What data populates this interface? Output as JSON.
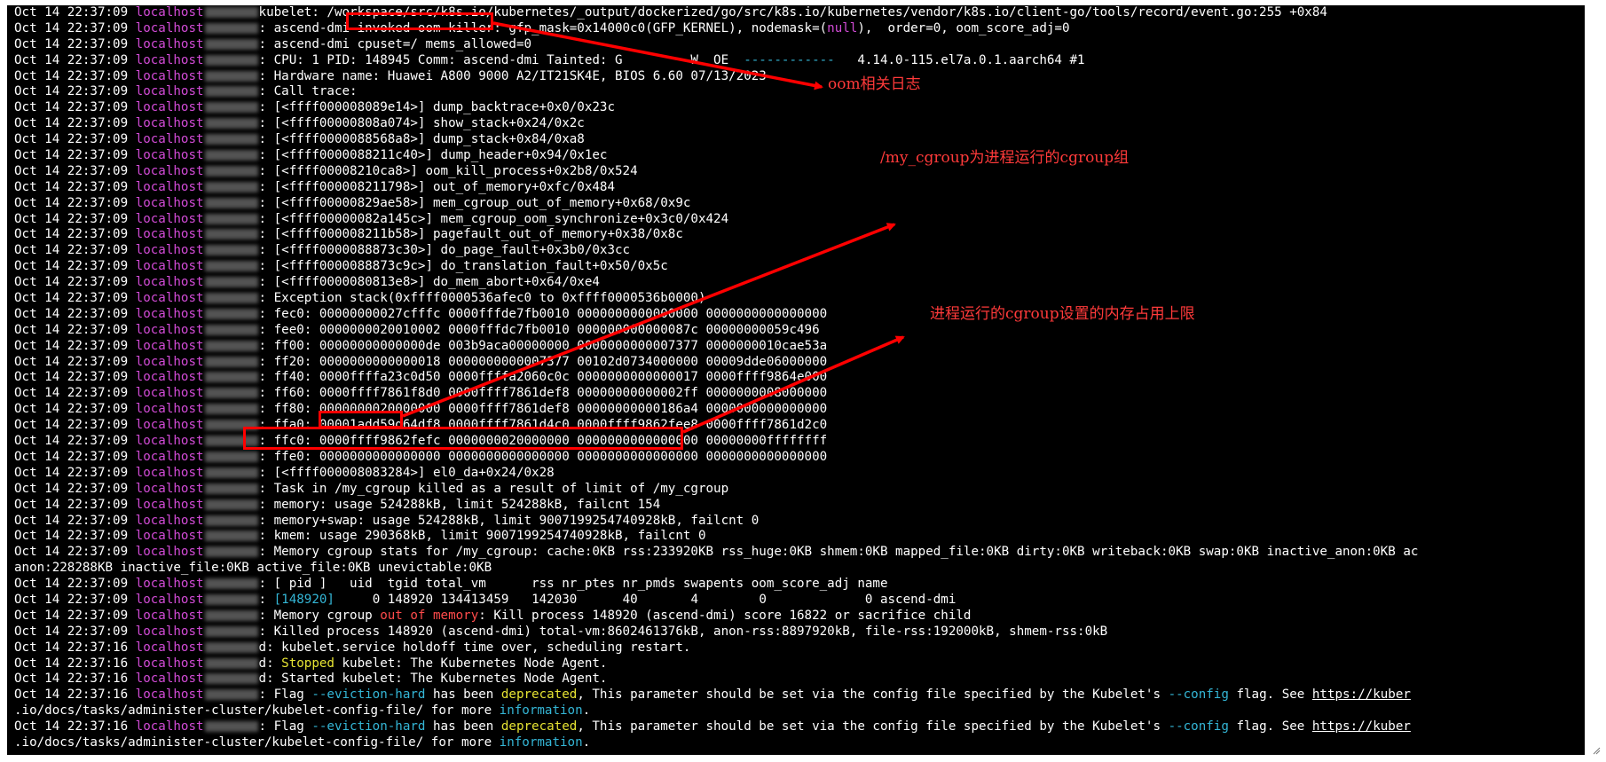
{
  "terminal": {
    "lines": [
      [
        {
          "t": "Oct 14 22:37:09 "
        },
        {
          "t": "localhost",
          "c": "host"
        },
        {
          "b": 1
        },
        {
          "t": "kubelet: /workspace/src/k8s.io/kubernetes/_output/dockerized/go/src/k8s.io/kubernetes/vendor/k8s.io/client-go/tools/record/event.go:255 +0x84"
        }
      ],
      [
        {
          "t": "Oct 14 22:37:09 "
        },
        {
          "t": "localhost",
          "c": "host"
        },
        {
          "b": 1
        },
        {
          "t": ": ascend-dmi invoked oom-killer: gfp_mask=0x14000c0(GFP_KERNEL), nodemask=("
        },
        {
          "t": "null",
          "c": "hl-magenta"
        },
        {
          "t": "),  order=0, oom_score_adj=0"
        }
      ],
      [
        {
          "t": "Oct 14 22:37:09 "
        },
        {
          "t": "localhost",
          "c": "host"
        },
        {
          "b": 1
        },
        {
          "t": ": ascend-dmi cpuset=/ mems_allowed=0"
        }
      ],
      [
        {
          "t": "Oct 14 22:37:09 "
        },
        {
          "t": "localhost",
          "c": "host"
        },
        {
          "b": 1
        },
        {
          "t": ": CPU: 1 PID: 148945 Comm: ascend-dmi Tainted: G         W  OE  "
        },
        {
          "t": "------------",
          "c": "hl-cyan"
        },
        {
          "t": "   4.14.0-115.el7a.0.1.aarch64 #1"
        }
      ],
      [
        {
          "t": "Oct 14 22:37:09 "
        },
        {
          "t": "localhost",
          "c": "host"
        },
        {
          "b": 1
        },
        {
          "t": ": Hardware name: Huawei A800 9000 A2/IT21SK4E, BIOS 6.60 07/13/2023"
        }
      ],
      [
        {
          "t": "Oct 14 22:37:09 "
        },
        {
          "t": "localhost",
          "c": "host"
        },
        {
          "b": 1
        },
        {
          "t": ": Call trace:"
        }
      ],
      [
        {
          "t": "Oct 14 22:37:09 "
        },
        {
          "t": "localhost",
          "c": "host"
        },
        {
          "b": 1
        },
        {
          "t": ": [<ffff000008089e14>] dump_backtrace+0x0/0x23c"
        }
      ],
      [
        {
          "t": "Oct 14 22:37:09 "
        },
        {
          "t": "localhost",
          "c": "host"
        },
        {
          "b": 1
        },
        {
          "t": ": [<ffff00000808a074>] show_stack+0x24/0x2c"
        }
      ],
      [
        {
          "t": "Oct 14 22:37:09 "
        },
        {
          "t": "localhost",
          "c": "host"
        },
        {
          "b": 1
        },
        {
          "t": ": [<ffff0000088568a8>] dump_stack+0x84/0xa8"
        }
      ],
      [
        {
          "t": "Oct 14 22:37:09 "
        },
        {
          "t": "localhost",
          "c": "host"
        },
        {
          "b": 1
        },
        {
          "t": ": [<ffff0000088211c40>] dump_header+0x94/0x1ec"
        }
      ],
      [
        {
          "t": "Oct 14 22:37:09 "
        },
        {
          "t": "localhost",
          "c": "host"
        },
        {
          "b": 1
        },
        {
          "t": ": [<ffff00008210ca8>] oom_kill_process+0x2b8/0x524"
        }
      ],
      [
        {
          "t": "Oct 14 22:37:09 "
        },
        {
          "t": "localhost",
          "c": "host"
        },
        {
          "b": 1
        },
        {
          "t": ": [<ffff000008211798>] out_of_memory+0xfc/0x484"
        }
      ],
      [
        {
          "t": "Oct 14 22:37:09 "
        },
        {
          "t": "localhost",
          "c": "host"
        },
        {
          "b": 1
        },
        {
          "t": ": [<ffff00000829ae58>] mem_cgroup_out_of_memory+0x68/0x9c"
        }
      ],
      [
        {
          "t": "Oct 14 22:37:09 "
        },
        {
          "t": "localhost",
          "c": "host"
        },
        {
          "b": 1
        },
        {
          "t": ": [<ffff00000082a145c>] mem_cgroup_oom_synchronize+0x3c0/0x424"
        }
      ],
      [
        {
          "t": "Oct 14 22:37:09 "
        },
        {
          "t": "localhost",
          "c": "host"
        },
        {
          "b": 1
        },
        {
          "t": ": [<ffff000008211b58>] pagefault_out_of_memory+0x38/0x8c"
        }
      ],
      [
        {
          "t": "Oct 14 22:37:09 "
        },
        {
          "t": "localhost",
          "c": "host"
        },
        {
          "b": 1
        },
        {
          "t": ": [<ffff0000088873c30>] do_page_fault+0x3b0/0x3cc"
        }
      ],
      [
        {
          "t": "Oct 14 22:37:09 "
        },
        {
          "t": "localhost",
          "c": "host"
        },
        {
          "b": 1
        },
        {
          "t": ": [<ffff0000088873c9c>] do_translation_fault+0x50/0x5c"
        }
      ],
      [
        {
          "t": "Oct 14 22:37:09 "
        },
        {
          "t": "localhost",
          "c": "host"
        },
        {
          "b": 1
        },
        {
          "t": ": [<ffff0000080813e8>] do_mem_abort+0x64/0xe4"
        }
      ],
      [
        {
          "t": "Oct 14 22:37:09 "
        },
        {
          "t": "localhost",
          "c": "host"
        },
        {
          "b": 1
        },
        {
          "t": ": Exception stack(0xffff0000536afec0 to 0xffff0000536b0000)"
        }
      ],
      [
        {
          "t": "Oct 14 22:37:09 "
        },
        {
          "t": "localhost",
          "c": "host"
        },
        {
          "b": 1
        },
        {
          "t": ": fec0: 00000000027cfffc 0000fffde7fb0010 0000000000000000 0000000000000000"
        }
      ],
      [
        {
          "t": "Oct 14 22:37:09 "
        },
        {
          "t": "localhost",
          "c": "host"
        },
        {
          "b": 1
        },
        {
          "t": ": fee0: 0000000020010002 0000fffdc7fb0010 000000000000087c 00000000059c496"
        }
      ],
      [
        {
          "t": "Oct 14 22:37:09 "
        },
        {
          "t": "localhost",
          "c": "host"
        },
        {
          "b": 1
        },
        {
          "t": ": ff00: 00000000000000de 003b9aca00000000 0000000000007377 0000000010cae53a"
        }
      ],
      [
        {
          "t": "Oct 14 22:37:09 "
        },
        {
          "t": "localhost",
          "c": "host"
        },
        {
          "b": 1
        },
        {
          "t": ": ff20: 0000000000000018 0000000000007377 00102d0734000000 00009dde06000000"
        }
      ],
      [
        {
          "t": "Oct 14 22:37:09 "
        },
        {
          "t": "localhost",
          "c": "host"
        },
        {
          "b": 1
        },
        {
          "t": ": ff40: 0000ffffa23c0d50 0000ffffa2060c0c 0000000000000017 0000ffff9864e000"
        }
      ],
      [
        {
          "t": "Oct 14 22:37:09 "
        },
        {
          "t": "localhost",
          "c": "host"
        },
        {
          "b": 1
        },
        {
          "t": ": ff60: 0000ffff7861f8d0 0000ffff7861def8 00000000000002ff 0000000008000000"
        }
      ],
      [
        {
          "t": "Oct 14 22:37:09 "
        },
        {
          "t": "localhost",
          "c": "host"
        },
        {
          "b": 1
        },
        {
          "t": ": ff80: 0000000020000000 0000ffff7861def8 00000000000186a4 0000000000000000"
        }
      ],
      [
        {
          "t": "Oct 14 22:37:09 "
        },
        {
          "t": "localhost",
          "c": "host"
        },
        {
          "b": 1
        },
        {
          "t": ": ffa0: 00001add59d64df8 0000ffff7861d4c0 0000ffff9862fee8 0000ffff7861d2c0"
        }
      ],
      [
        {
          "t": "Oct 14 22:37:09 "
        },
        {
          "t": "localhost",
          "c": "host"
        },
        {
          "b": 1
        },
        {
          "t": ": ffc0: 0000ffff9862fefc 0000000020000000 0000000000000000 00000000ffffffff"
        }
      ],
      [
        {
          "t": "Oct 14 22:37:09 "
        },
        {
          "t": "localhost",
          "c": "host"
        },
        {
          "b": 1
        },
        {
          "t": ": ffe0: 0000000000000000 0000000000000000 0000000000000000 0000000000000000"
        }
      ],
      [
        {
          "t": "Oct 14 22:37:09 "
        },
        {
          "t": "localhost",
          "c": "host"
        },
        {
          "b": 1
        },
        {
          "t": ": [<ffff000008083284>] el0_da+0x24/0x28"
        }
      ],
      [
        {
          "t": "Oct 14 22:37:09 "
        },
        {
          "t": "localhost",
          "c": "host"
        },
        {
          "b": 1
        },
        {
          "t": ": Task in /my_cgroup killed as a result of limit of /my_cgroup"
        }
      ],
      [
        {
          "t": "Oct 14 22:37:09 "
        },
        {
          "t": "localhost",
          "c": "host"
        },
        {
          "b": 1
        },
        {
          "t": ": memory: usage 524288kB, limit 524288kB, failcnt 154"
        }
      ],
      [
        {
          "t": "Oct 14 22:37:09 "
        },
        {
          "t": "localhost",
          "c": "host"
        },
        {
          "b": 1
        },
        {
          "t": ": memory+swap: usage 524288kB, limit 9007199254740928kB, failcnt 0"
        }
      ],
      [
        {
          "t": "Oct 14 22:37:09 "
        },
        {
          "t": "localhost",
          "c": "host"
        },
        {
          "b": 1
        },
        {
          "t": ": kmem: usage 290368kB, limit 9007199254740928kB, failcnt 0"
        }
      ],
      [
        {
          "t": "Oct 14 22:37:09 "
        },
        {
          "t": "localhost",
          "c": "host"
        },
        {
          "b": 1
        },
        {
          "t": ": Memory cgroup stats for /my_cgroup: cache:0KB rss:233920KB rss_huge:0KB shmem:0KB mapped_file:0KB dirty:0KB writeback:0KB swap:0KB inactive_anon:0KB ac"
        }
      ],
      [
        {
          "t": "anon:228288KB inactive_file:0KB active_file:0KB unevictable:0KB"
        }
      ],
      [
        {
          "t": "Oct 14 22:37:09 "
        },
        {
          "t": "localhost",
          "c": "host"
        },
        {
          "b": 1
        },
        {
          "t": ": [ pid ]   uid  tgid total_vm      rss nr_ptes nr_pmds swapents oom_score_adj name"
        }
      ],
      [
        {
          "t": "Oct 14 22:37:09 "
        },
        {
          "t": "localhost",
          "c": "host"
        },
        {
          "b": 1
        },
        {
          "t": ": "
        },
        {
          "t": "[148920]",
          "c": "hl-cyan"
        },
        {
          "t": "     0 148920 134413459   142030      40       4        0             0 ascend-dmi"
        }
      ],
      [
        {
          "t": "Oct 14 22:37:09 "
        },
        {
          "t": "localhost",
          "c": "host"
        },
        {
          "b": 1
        },
        {
          "t": ": Memory cgroup "
        },
        {
          "t": "out of memory",
          "c": "hl-red"
        },
        {
          "t": ": Kill process 148920 (ascend-dmi) score 16822 or sacrifice child"
        }
      ],
      [
        {
          "t": "Oct 14 22:37:09 "
        },
        {
          "t": "localhost",
          "c": "host"
        },
        {
          "b": 1
        },
        {
          "t": ": Killed process 148920 (ascend-dmi) total-vm:8602461376kB, anon-rss:8897920kB, file-rss:192000kB, shmem-rss:0kB"
        }
      ],
      [
        {
          "t": "Oct 14 22:37:16 "
        },
        {
          "t": "localhost",
          "c": "host"
        },
        {
          "b": 1
        },
        {
          "t": "d: kubelet.service holdoff time over, scheduling restart."
        }
      ],
      [
        {
          "t": "Oct 14 22:37:16 "
        },
        {
          "t": "localhost",
          "c": "host"
        },
        {
          "b": 1
        },
        {
          "t": "d: "
        },
        {
          "t": "Stopped",
          "c": "hl-yellow"
        },
        {
          "t": " kubelet: The Kubernetes Node Agent."
        }
      ],
      [
        {
          "t": "Oct 14 22:37:16 "
        },
        {
          "t": "localhost",
          "c": "host"
        },
        {
          "b": 1
        },
        {
          "t": "d: Started kubelet: The Kubernetes Node Agent."
        }
      ],
      [
        {
          "t": "Oct 14 22:37:16 "
        },
        {
          "t": "localhost",
          "c": "host"
        },
        {
          "b": 1
        },
        {
          "t": ": Flag "
        },
        {
          "t": "--eviction-hard",
          "c": "hl-cyan"
        },
        {
          "t": " has been "
        },
        {
          "t": "deprecated",
          "c": "hl-yellow"
        },
        {
          "t": ", This parameter should be set via the config file specified by the Kubelet's "
        },
        {
          "t": "--config",
          "c": "hl-cyan"
        },
        {
          "t": " flag. See "
        },
        {
          "t": "https://kuber",
          "c": "link"
        }
      ],
      [
        {
          "t": ".io/docs/tasks/administer-cluster/kubelet-config-file/ for more "
        },
        {
          "t": "information",
          "c": "hl-cyan"
        },
        {
          "t": "."
        }
      ],
      [
        {
          "t": "Oct 14 22:37:16 "
        },
        {
          "t": "localhost",
          "c": "host"
        },
        {
          "b": 1
        },
        {
          "t": ": Flag "
        },
        {
          "t": "--eviction-hard",
          "c": "hl-cyan"
        },
        {
          "t": " has been "
        },
        {
          "t": "deprecated",
          "c": "hl-yellow"
        },
        {
          "t": ", This parameter should be set via the config file specified by the Kubelet's "
        },
        {
          "t": "--config",
          "c": "hl-cyan"
        },
        {
          "t": " flag. See "
        },
        {
          "t": "https://kuber",
          "c": "link"
        }
      ],
      [
        {
          "t": ".io/docs/tasks/administer-cluster/kubelet-config-file/ for more "
        },
        {
          "t": "information",
          "c": "hl-cyan"
        },
        {
          "t": "."
        }
      ]
    ]
  },
  "annotations": {
    "oom_log": "oom相关日志",
    "cgroup_group": "/my_cgroup为进程运行的cgroup组",
    "cgroup_limit": "进程运行的cgroup设置的内存占用上限"
  },
  "colors": {
    "terminal_bg": "#000000",
    "text": "#ffffff",
    "hostname": "#d24bd6",
    "annotation": "#ff0000"
  }
}
